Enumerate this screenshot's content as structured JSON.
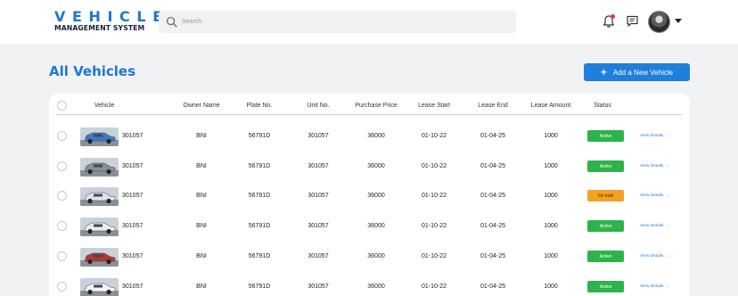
{
  "brand": {
    "title": "VEHICLE",
    "subtitle": "MANAGEMENT SYSTEM"
  },
  "search": {
    "placeholder": "Search",
    "icon": "search-icon"
  },
  "header_icons": [
    "bell-icon",
    "chat-icon",
    "avatar"
  ],
  "page": {
    "title": "All Vehicles",
    "add_button_label": "Add a New Vehicle"
  },
  "colors": {
    "brand": "#1f77d0",
    "primary_button": "#1e7fdc",
    "active": "#2db34a",
    "on_hold": "#f2a222"
  },
  "table": {
    "columns": [
      "Vehicle",
      "Owner Name",
      "Plate No.",
      "Unit No.",
      "Purchase Price",
      "Lease Start",
      "Lease End",
      "Lease Amount",
      "Status"
    ],
    "rows": [
      {
        "vehicle": "301057",
        "owner": "BNI",
        "plate": "56791D",
        "unit": "301057",
        "price": "36000",
        "lease_start": "01-10-22",
        "lease_end": "01-04-25",
        "lease_amount": "1000",
        "status": "Active",
        "link": "View Details →",
        "thumb_color": "#3d78c9"
      },
      {
        "vehicle": "301057",
        "owner": "BNI",
        "plate": "56791D",
        "unit": "301057",
        "price": "36000",
        "lease_start": "01-10-22",
        "lease_end": "01-04-25",
        "lease_amount": "1000",
        "status": "Active",
        "link": "View Details →",
        "thumb_color": "#8a8f96"
      },
      {
        "vehicle": "301057",
        "owner": "BNI",
        "plate": "56791D",
        "unit": "301057",
        "price": "36000",
        "lease_start": "01-10-22",
        "lease_end": "01-04-25",
        "lease_amount": "1000",
        "status": "On hold",
        "link": "View Details →",
        "thumb_color": "#dfe2e6"
      },
      {
        "vehicle": "301057",
        "owner": "BNI",
        "plate": "56791D",
        "unit": "301057",
        "price": "36000",
        "lease_start": "01-10-22",
        "lease_end": "01-04-25",
        "lease_amount": "1000",
        "status": "Active",
        "link": "View Details →",
        "thumb_color": "#e9ecef"
      },
      {
        "vehicle": "301057",
        "owner": "BNI",
        "plate": "56791D",
        "unit": "301057",
        "price": "36000",
        "lease_start": "01-10-22",
        "lease_end": "01-04-25",
        "lease_amount": "1000",
        "status": "Active",
        "link": "View Details →",
        "thumb_color": "#b23a33"
      },
      {
        "vehicle": "301057",
        "owner": "BNI",
        "plate": "56791D",
        "unit": "301057",
        "price": "36000",
        "lease_start": "01-10-22",
        "lease_end": "01-04-25",
        "lease_amount": "1000",
        "status": "Active",
        "link": "View Details →",
        "thumb_color": "#f1f3f5"
      }
    ]
  }
}
